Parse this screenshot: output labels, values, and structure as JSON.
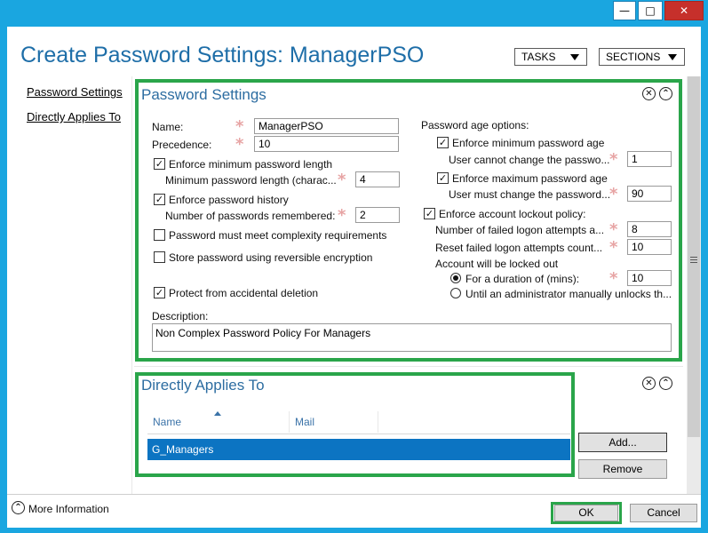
{
  "window": {
    "minimize": "—",
    "maximize": "□",
    "close": "✕",
    "title": "Create Password Settings: ManagerPSO"
  },
  "header": {
    "tasks_label": "TASKS",
    "sections_label": "SECTIONS"
  },
  "nav": {
    "items": [
      {
        "label": "Password Settings"
      },
      {
        "label": "Directly Applies To"
      }
    ]
  },
  "password_settings": {
    "title": "Password Settings",
    "name_label": "Name:",
    "name_value": "ManagerPSO",
    "precedence_label": "Precedence:",
    "precedence_value": "10",
    "enforce_min_length_label": "Enforce minimum password length",
    "min_length_label": "Minimum password length (charac...",
    "min_length_value": "4",
    "enforce_history_label": "Enforce password history",
    "history_label": "Number of passwords remembered:",
    "history_value": "2",
    "complexity_label": "Password must meet complexity requirements",
    "reversible_label": "Store password using reversible encryption",
    "protect_label": "Protect from accidental deletion",
    "age_options_label": "Password age options:",
    "enforce_min_age_label": "Enforce minimum password age",
    "min_age_label": "User cannot change the passwo...",
    "min_age_value": "1",
    "enforce_max_age_label": "Enforce maximum password age",
    "max_age_label": "User must change the password...",
    "max_age_value": "90",
    "lockout_label": "Enforce account lockout policy:",
    "failed_attempts_label": "Number of failed logon attempts a...",
    "failed_attempts_value": "8",
    "reset_label": "Reset failed logon attempts count...",
    "reset_value": "10",
    "locked_out_label": "Account will be locked out",
    "duration_label": "For a duration of (mins):",
    "duration_value": "10",
    "until_admin_label": "Until an administrator manually unlocks th...",
    "description_label": "Description:",
    "description_value": "Non Complex Password Policy For Managers",
    "checks": {
      "enforce_min_length": true,
      "enforce_history": true,
      "complexity": false,
      "reversible": false,
      "protect": true,
      "enforce_min_age": true,
      "enforce_max_age": true,
      "lockout": true
    },
    "check_glyph": "✓",
    "radio_selected": "duration"
  },
  "applies_to": {
    "title": "Directly Applies To",
    "columns": [
      "Name",
      "Mail"
    ],
    "rows": [
      {
        "name": "G_Managers",
        "mail": ""
      }
    ],
    "add_label": "Add...",
    "remove_label": "Remove"
  },
  "section_controls": {
    "close_glyph": "✕",
    "collapse_glyph": "⌃"
  },
  "footer": {
    "more_info_label": "More Information",
    "ok_label": "OK",
    "cancel_label": "Cancel",
    "more_info_glyph": "⌃"
  },
  "colors": {
    "accent": "#1e6ea8",
    "highlight": "#2aa54a",
    "selection": "#0c74c2",
    "window_border": "#1aa6e0"
  }
}
